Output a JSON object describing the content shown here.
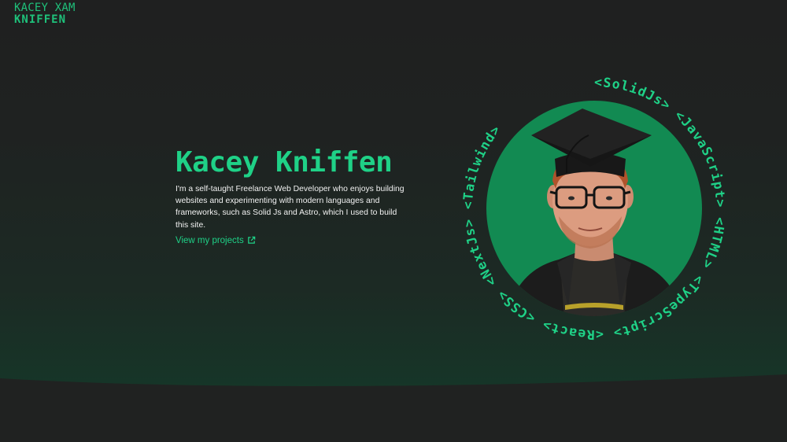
{
  "header": {
    "logo_line1": "KACEY XAM",
    "logo_line2": "KNIFFEN"
  },
  "hero": {
    "title": "Kacey Kniffen",
    "description": "I'm a self-taught Freelance Web Developer who enjoys building websites and experimenting with modern languages and frameworks, such as Solid Js and Astro, which I used to build this site.",
    "projects_link": "View my projects",
    "link_icon": "external-link-icon"
  },
  "portrait": {
    "alt": "Kacey Kniffen in graduation cap",
    "ring_text": "<SolidJs> <JavaScript> <HTML> <TypeScript> <React> <CSS> <NextJs> <Tailwind>",
    "tags": [
      "<SolidJs>",
      "<JavaScript>",
      "<HTML>",
      "<TypeScript>",
      "<React>",
      "<CSS>",
      "<NextJs>",
      "<Tailwind>"
    ]
  },
  "colors": {
    "accent": "#1fd187",
    "circle": "#128a52",
    "background": "#202221",
    "text": "#f2f2f2"
  }
}
